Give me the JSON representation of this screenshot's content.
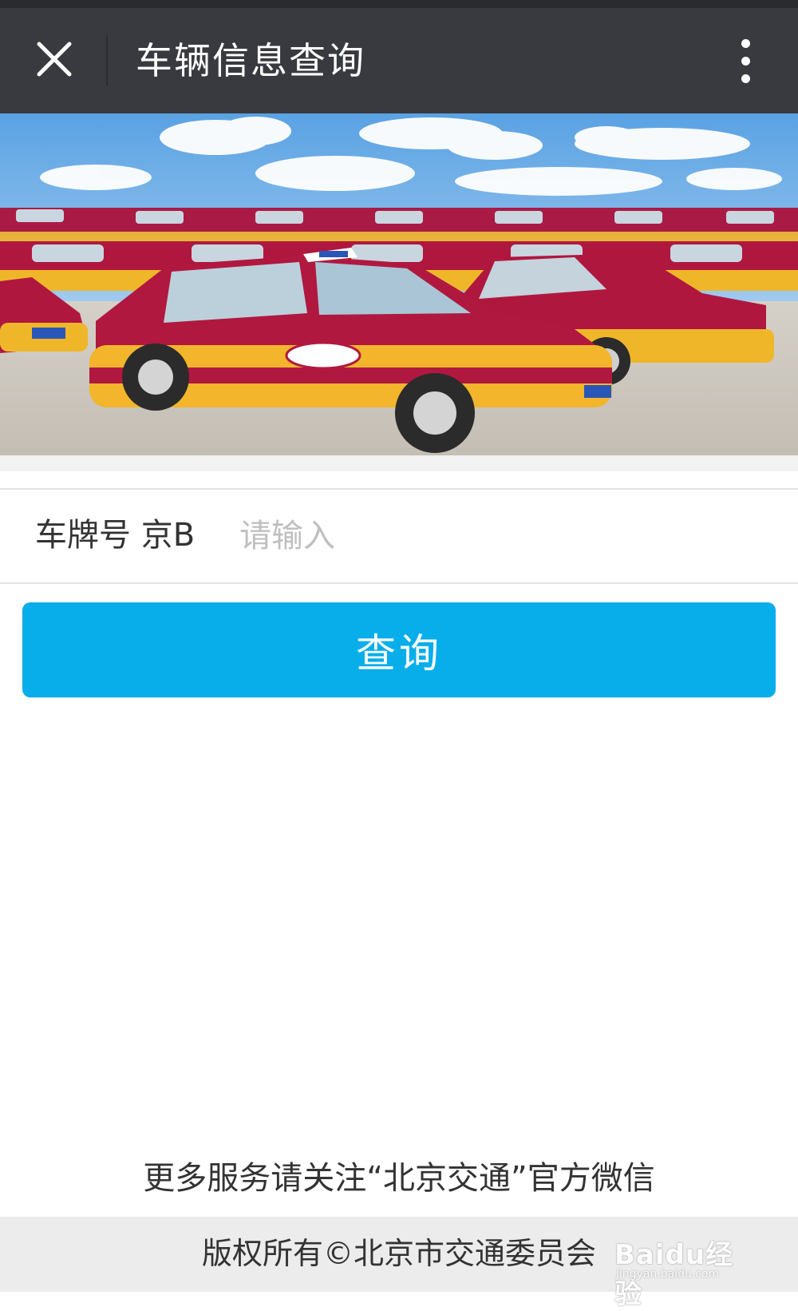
{
  "navbar": {
    "close_icon": "close-icon",
    "title": "车辆信息查询",
    "more_icon": "more-vertical-icon"
  },
  "banner": {
    "subject": "taxi-fleet-photo",
    "colors": {
      "sky": "#7db8ea",
      "cloud": "#ffffff",
      "car_red": "#b0173f",
      "car_yellow": "#f0b62a",
      "ground": "#c8c3ba"
    }
  },
  "form": {
    "plate_label": "车牌号 京B",
    "plate_input_value": "",
    "plate_input_placeholder": "请输入"
  },
  "query_button": {
    "label": "查询",
    "color": "#08aeea"
  },
  "footer": {
    "note": "更多服务请关注“北京交通”官方微信",
    "copyright": "版权所有©北京市交通委员会"
  },
  "watermark": {
    "brand": "Baidu经验",
    "domain": "jingyan.baidu.com"
  }
}
